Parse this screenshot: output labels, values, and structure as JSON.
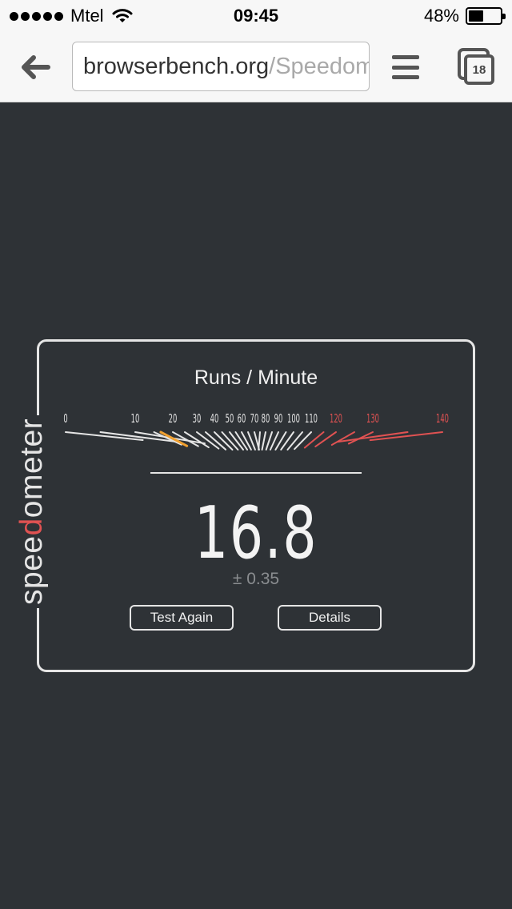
{
  "status_bar": {
    "carrier": "Mtel",
    "time": "09:45",
    "battery_percent": "48%",
    "battery_level": 0.48,
    "signal_bars": 5
  },
  "browser": {
    "url_host": "browserbench.org",
    "url_path": "/Speedometer",
    "tab_count": "18"
  },
  "speedometer": {
    "logo_text": "speedometer",
    "title": "Runs / Minute",
    "score": "16.8",
    "margin": "± 0.35",
    "needle_value": 16.8,
    "scale_labels": [
      "0",
      "10",
      "20",
      "30",
      "40",
      "50",
      "60",
      "70",
      "80",
      "90",
      "100",
      "110",
      "120",
      "130",
      "140"
    ],
    "danger_labels": [
      "120",
      "130",
      "140"
    ],
    "test_again_label": "Test Again",
    "details_label": "Details"
  },
  "colors": {
    "background": "#2e3236",
    "foreground": "#e5e5e5",
    "needle": "#f0a030",
    "danger": "#e05252"
  }
}
